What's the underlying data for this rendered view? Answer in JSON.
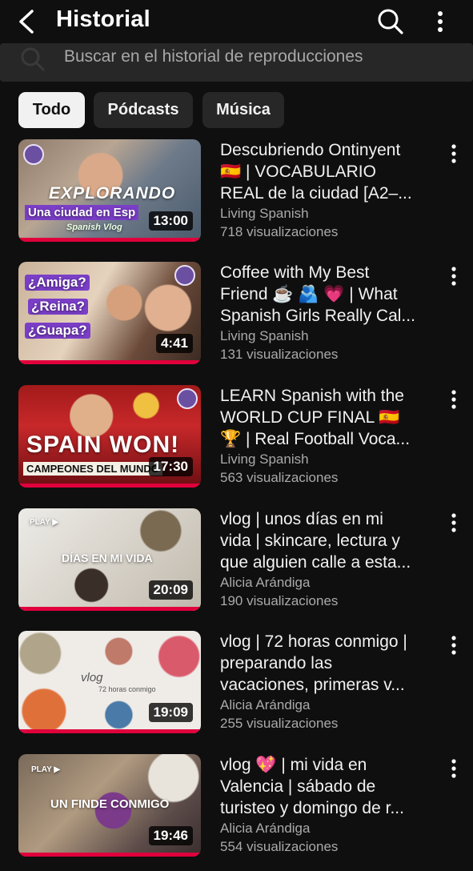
{
  "header": {
    "title": "Historial",
    "back_icon": "chevron-left-icon",
    "search_icon": "search-icon",
    "more_icon": "more-vertical-icon"
  },
  "search": {
    "placeholder": "Buscar en el historial de reproducciones",
    "icon": "search-icon"
  },
  "chips": [
    {
      "label": "Todo",
      "active": true
    },
    {
      "label": "Pódcasts",
      "active": false
    },
    {
      "label": "Música",
      "active": false
    }
  ],
  "videos": [
    {
      "title_lines": [
        "Descubriendo Ontinyent",
        "🇪🇸 | VOCABULARIO",
        "REAL de la ciudad [A2–..."
      ],
      "channel": "Living Spanish",
      "views": "718 visualizaciones",
      "duration": "13:00",
      "overlay": [
        "EXPLORANDO",
        "Una ciudad en Esp",
        "Spanish Vlog"
      ]
    },
    {
      "title_lines": [
        "Coffee with My Best",
        "Friend ☕ 🫂 💗 | What",
        "Spanish Girls Really Cal..."
      ],
      "channel": "Living Spanish",
      "views": "131 visualizaciones",
      "duration": "4:41",
      "overlay": [
        "¿Amiga?",
        "¿Reina?",
        "¿Guapa?"
      ]
    },
    {
      "title_lines": [
        "LEARN Spanish with the",
        "WORLD CUP FINAL 🇪🇸",
        "🏆 | Real Football Voca..."
      ],
      "channel": "Living Spanish",
      "views": "563 visualizaciones",
      "duration": "17:30",
      "overlay": [
        "SPAIN WON!",
        "CAMPEONES DEL MUNDO"
      ]
    },
    {
      "title_lines": [
        "vlog | unos días en mi",
        "vida | skincare, lectura y",
        "que alguien calle a esta..."
      ],
      "channel": "Alicia Arándiga",
      "views": "190 visualizaciones",
      "duration": "20:09",
      "overlay": [
        "PLAY ▶",
        "DÍAS EN MI VIDA"
      ]
    },
    {
      "title_lines": [
        "vlog | 72 horas conmigo |",
        "preparando las",
        "vacaciones, primeras v..."
      ],
      "channel": "Alicia Arándiga",
      "views": "255 visualizaciones",
      "duration": "19:09",
      "overlay": [
        "vlog",
        "72 horas conmigo"
      ]
    },
    {
      "title_lines": [
        "vlog 💖 | mi vida en",
        "Valencia | sábado de",
        "turisteo y domingo de r..."
      ],
      "channel": "Alicia Arándiga",
      "views": "554 visualizaciones",
      "duration": "19:46",
      "overlay": [
        "PLAY ▶",
        "UN FINDE CONMIGO"
      ]
    }
  ],
  "colors": {
    "background": "#0f0f0f",
    "surface": "#272727",
    "progress": "#e0003c",
    "text_primary": "#f1f1f1",
    "text_secondary": "#aaaaaa"
  }
}
